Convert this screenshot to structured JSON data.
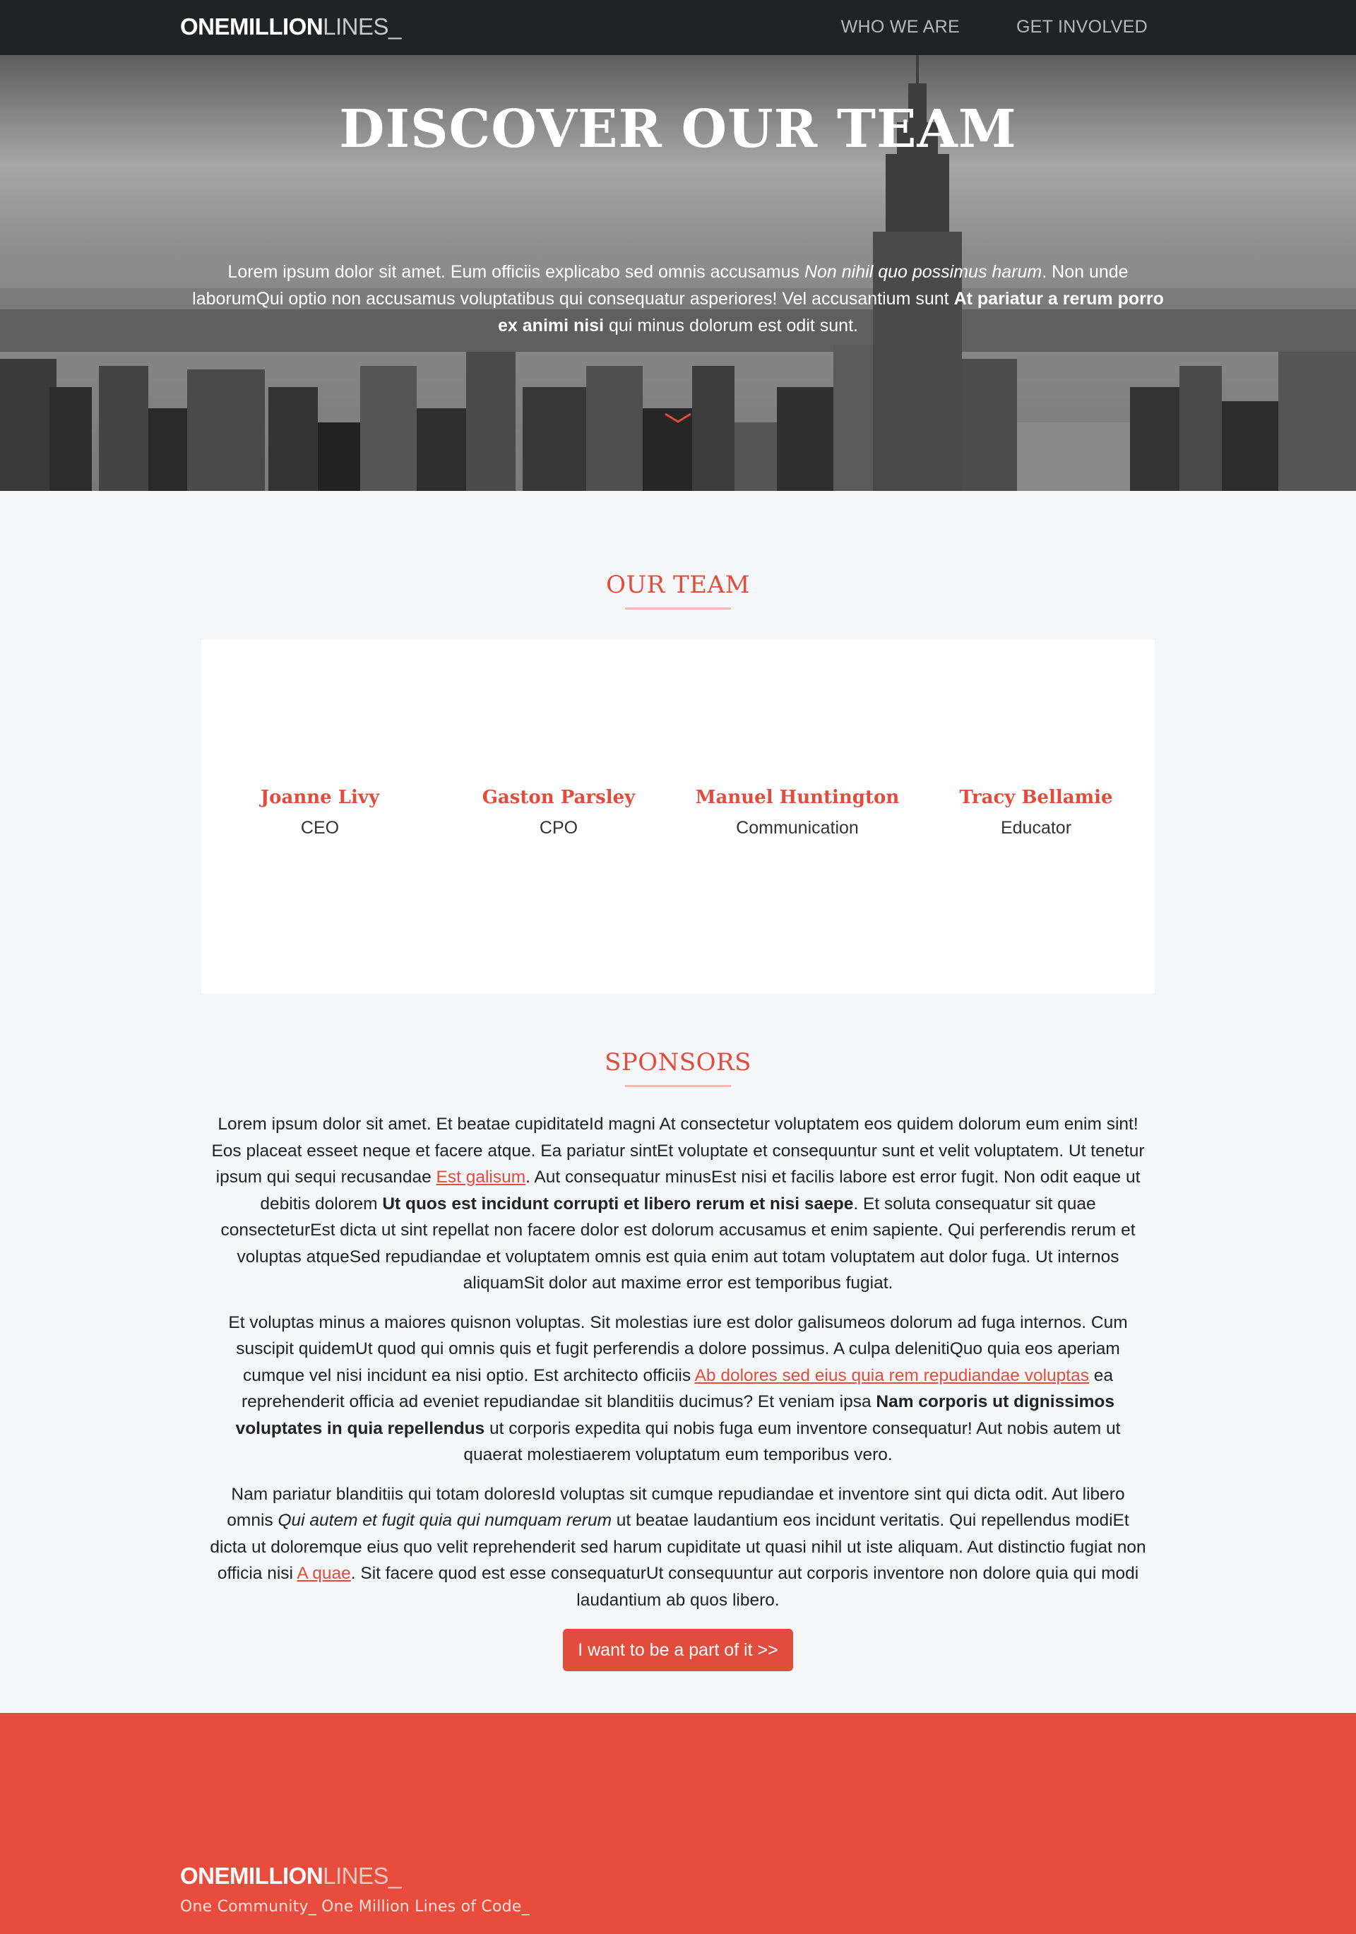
{
  "nav": {
    "logo_bold": "ONEMILLION",
    "logo_light": "LINES_",
    "links": [
      "WHO WE ARE",
      "GET INVOLVED"
    ]
  },
  "hero": {
    "title": "DISCOVER OUR TEAM",
    "text": {
      "p1": "Lorem ipsum dolor sit amet. Eum officiis explicabo sed omnis accusamus ",
      "em1": "Non nihil quo possimus harum",
      "p2": ". Non unde laborumQui optio non accusamus voluptatibus qui consequatur asperiores! Vel accusantium sunt ",
      "strong1": "At pariatur a rerum porro ex animi nisi",
      "p3": " qui minus dolorum est odit sunt."
    }
  },
  "team": {
    "title": "OUR TEAM",
    "members": [
      {
        "name": "Joanne Livy",
        "role": "CEO"
      },
      {
        "name": "Gaston Parsley",
        "role": "CPO"
      },
      {
        "name": "Manuel Huntington",
        "role": "Communication"
      },
      {
        "name": "Tracy Bellamie",
        "role": "Educator"
      }
    ]
  },
  "sponsors": {
    "title": "SPONSORS",
    "para1": {
      "a": "Lorem ipsum dolor sit amet. Et beatae cupiditateId magni At consectetur voluptatem eos quidem dolorum eum enim sint! Eos placeat esseet neque et facere atque. Ea pariatur sintEt voluptate et consequuntur sunt et velit voluptatem. Ut tenetur ipsum qui sequi recusandae ",
      "link": "Est galisum",
      "b": ". Aut consequatur minusEst nisi et facilis labore est error fugit. Non odit eaque ut debitis dolorem ",
      "strong": "Ut quos est incidunt corrupti et libero rerum et nisi saepe",
      "c": ". Et soluta consequatur sit quae consecteturEst dicta ut sint repellat non facere dolor est dolorum accusamus et enim sapiente. Qui perferendis rerum et voluptas atqueSed repudiandae et voluptatem omnis est quia enim aut totam voluptatem aut dolor fuga. Ut internos aliquamSit dolor aut maxime error est temporibus fugiat."
    },
    "para2": {
      "a": "Et voluptas minus a maiores quisnon voluptas. Sit molestias iure est dolor galisumeos dolorum ad fuga internos. Cum suscipit quidemUt quod qui omnis quis et fugit perferendis a dolore possimus. A culpa delenitiQuo quia eos aperiam cumque vel nisi incidunt ea nisi optio. Est architecto officiis ",
      "link": "Ab dolores sed eius quia rem repudiandae voluptas",
      "b": " ea reprehenderit officia ad eveniet repudiandae sit blanditiis ducimus? Et veniam ipsa ",
      "strong": "Nam corporis ut dignissimos voluptates in quia repellendus",
      "c": " ut corporis expedita qui nobis fuga eum inventore consequatur! Aut nobis autem ut quaerat molestiaerem voluptatum eum temporibus vero."
    },
    "para3": {
      "a": "Nam pariatur blanditiis qui totam doloresId voluptas sit cumque repudiandae et inventore sint qui dicta odit. Aut libero omnis ",
      "em": "Qui autem et fugit quia qui numquam rerum",
      "b": " ut beatae laudantium eos incidunt veritatis. Qui repellendus modiEt dicta ut doloremque eius quo velit reprehenderit sed harum cupiditate ut quasi nihil ut iste aliquam. Aut distinctio fugiat non officia nisi ",
      "link": "A quae",
      "c": ". Sit facere quod est esse consequaturUt consequuntur aut corporis inventore non dolore quia qui modi laudantium ab quos libero."
    },
    "cta": "I want to be a part of it >>"
  },
  "footer": {
    "logo_bold": "ONEMILLION",
    "logo_light": "LINES_",
    "tagline": "One Community_ One Million Lines of Code_"
  },
  "colors": {
    "accent": "#e24c3c",
    "nav_bg": "#202226",
    "footer_bg": "#e84c3d",
    "page_bg": "#f5f6f8"
  },
  "icons": [
    "chevron-down-icon"
  ]
}
